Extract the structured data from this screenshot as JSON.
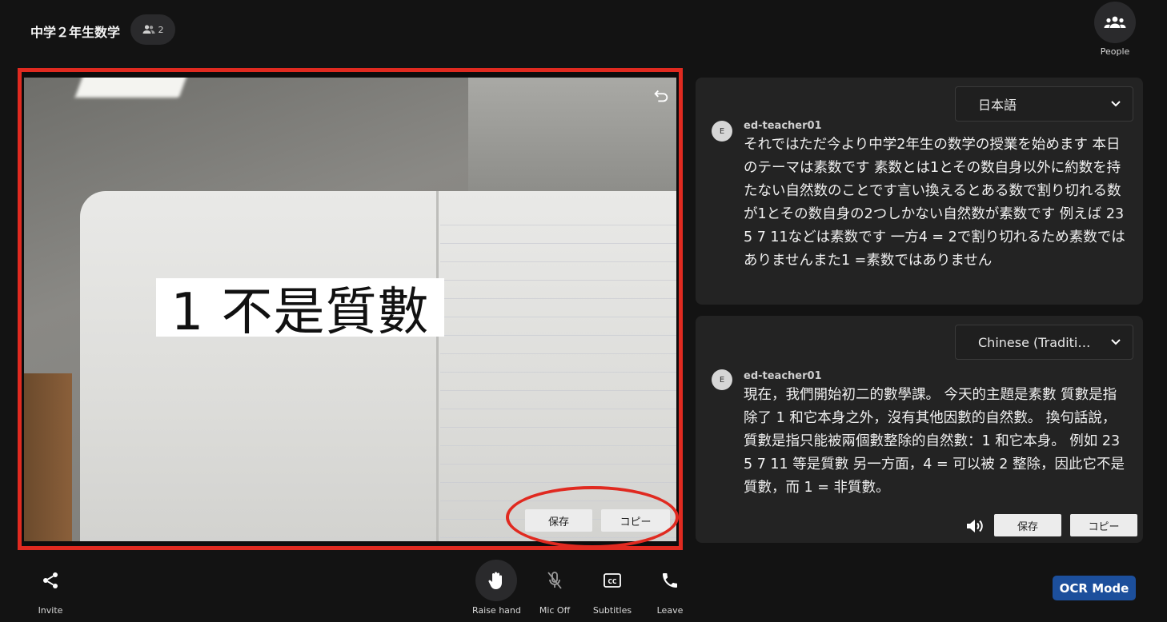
{
  "header": {
    "title": "中学２年生数学",
    "participant_count": "2",
    "people_label": "People"
  },
  "video": {
    "ocr_text": "1 不是質數",
    "save_label": "保存",
    "copy_label": "コピー"
  },
  "transcripts": [
    {
      "language": "日本語",
      "avatar": "E",
      "speaker": "ed-teacher01",
      "text": "それではただ今より中学2年生の数学の授業を始めます 本日のテーマは素数です 素数とは1とその数自身以外に約数を持たない自然数のことです言い換えるとある数で割り切れる数が1とその数自身の2つしかない自然数が素数です 例えば 23 5 7 11などは素数です 一方4 = 2で割り切れるため素数ではありませんまた1 =素数ではありません"
    },
    {
      "language": "Chinese (Traditi…",
      "avatar": "E",
      "speaker": "ed-teacher01",
      "text": "現在，我們開始初二的數學課。 今天的主題是素數 質數是指除了 1 和它本身之外，沒有其他因數的自然數。 換句話說，質數是指只能被兩個數整除的自然數：1 和它本身。 例如 23 5 7 11 等是質數 另一方面，4 = 可以被 2 整除，因此它不是質數，而 1 = 非質數。",
      "save_label": "保存",
      "copy_label": "コピー"
    }
  ],
  "toolbar": {
    "invite": "Invite",
    "raise_hand": "Raise hand",
    "mic_off": "Mic Off",
    "subtitles": "Subtitles",
    "leave": "Leave",
    "ocr_mode": "OCR Mode"
  },
  "colors": {
    "highlight": "#e02a20",
    "ocr_button": "#1c4f9c",
    "panel": "#232323",
    "background": "#131313"
  }
}
